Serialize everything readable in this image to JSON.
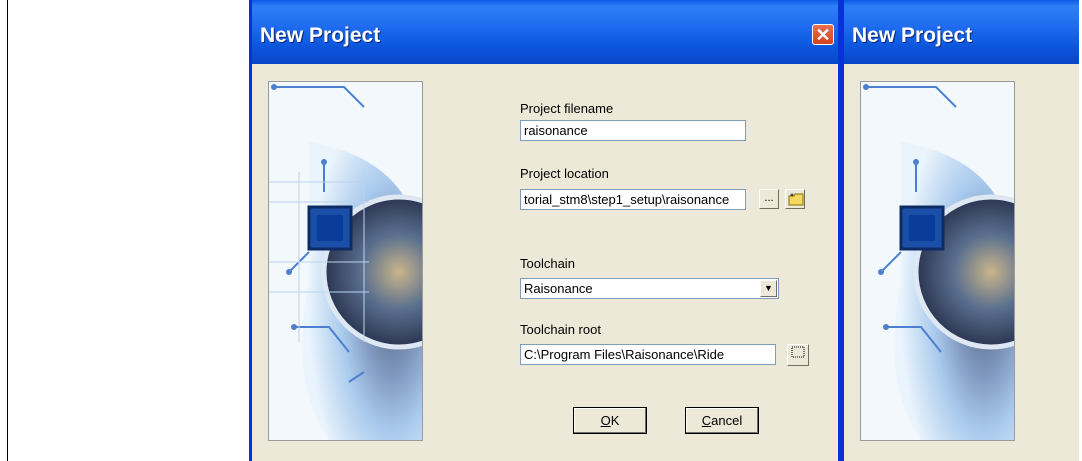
{
  "dialog": {
    "title": "New Project",
    "close_symbol": "✕",
    "fields": {
      "project_filename_label": "Project filename",
      "project_filename_value": "raisonance",
      "project_location_label": "Project location",
      "project_location_value": "torial_stm8\\step1_setup\\raisonance",
      "browse_label": "...",
      "toolchain_label": "Toolchain",
      "toolchain_value": "Raisonance",
      "toolchain_root_label": "Toolchain root",
      "toolchain_root_value": "C:\\Program Files\\Raisonance\\Ride"
    },
    "buttons": {
      "ok_mnemonic": "O",
      "ok_rest": "K",
      "cancel_mnemonic": "C",
      "cancel_rest": "ancel"
    }
  },
  "second_dialog": {
    "title": "New Project"
  },
  "icons": [
    "close-icon",
    "browse-icon",
    "new-folder-icon",
    "dropdown-arrow-icon",
    "folder-browse-icon"
  ],
  "colors": {
    "titlebar": "#0A5BE8",
    "window_bg": "#ECE9D8",
    "border": "#0831D9",
    "close": "#D4421E"
  }
}
